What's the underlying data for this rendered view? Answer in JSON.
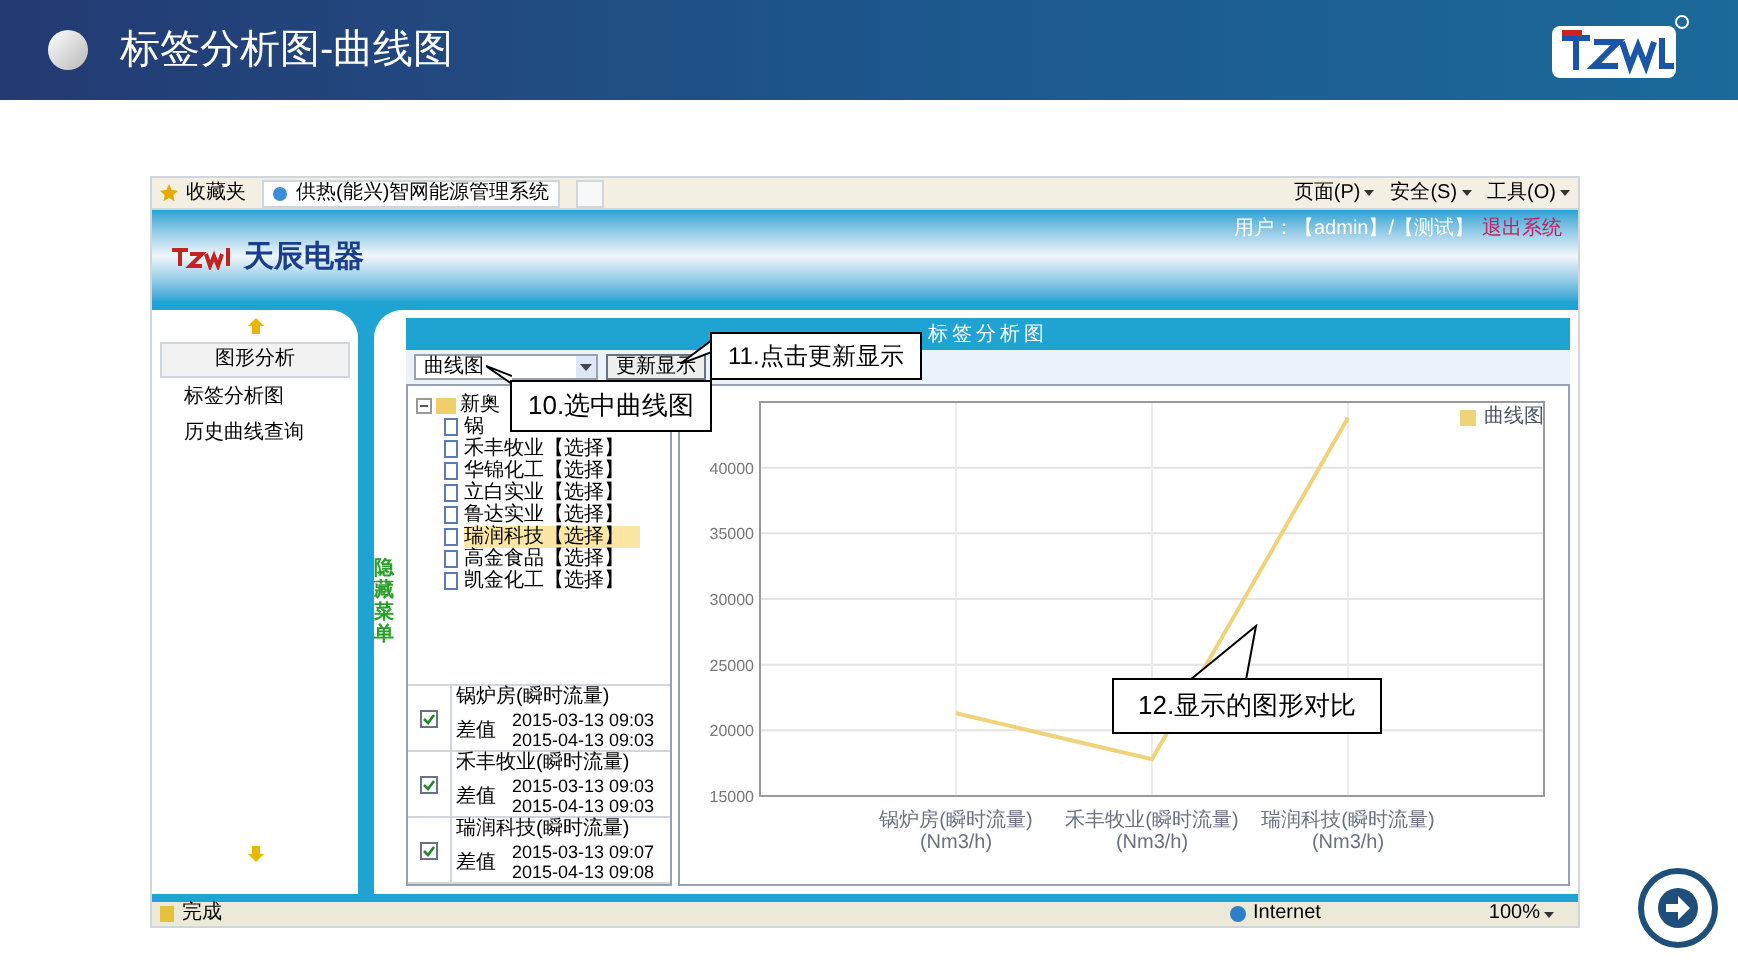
{
  "slide": {
    "title": "标签分析图-曲线图"
  },
  "browser": {
    "favorites": "收藏夹",
    "tab": "供热(能兴)智网能源管理系统",
    "menus": [
      "页面(P)",
      "安全(S)",
      "工具(O)"
    ],
    "status": "完成",
    "zone": "Internet",
    "zoom": "100%"
  },
  "app": {
    "brand": "天辰电器",
    "user": "用户：【admin】/【测试】",
    "logout": "退出系统",
    "sidebar": {
      "items": [
        {
          "label": "图形分析",
          "selected": true
        },
        {
          "label": "标签分析图",
          "selected": false
        },
        {
          "label": "历史曲线查询",
          "selected": false
        }
      ]
    },
    "hide_menu": "隐藏菜单",
    "panel_title": "标签分析图",
    "chart_type": {
      "value": "曲线图"
    },
    "update_button": "更新显示",
    "tree": {
      "label": "新奥",
      "expanded": true,
      "children": [
        {
          "label": "锅",
          "selected": false
        },
        {
          "label": "禾丰牧业【选择】",
          "selected": false
        },
        {
          "label": "华锦化工【选择】",
          "selected": false
        },
        {
          "label": "立白实业【选择】",
          "selected": false
        },
        {
          "label": "鲁达实业【选择】",
          "selected": false
        },
        {
          "label": "瑞润科技【选择】",
          "selected": true
        },
        {
          "label": "高金食品【选择】",
          "selected": false
        },
        {
          "label": "凯金化工【选择】",
          "selected": false
        }
      ]
    },
    "tags": [
      {
        "name": "锅炉房(瞬时流量)",
        "checked": true,
        "mode": "差值",
        "start": "2015-03-13 09:03",
        "end": "2015-04-13 09:03"
      },
      {
        "name": "禾丰牧业(瞬时流量)",
        "checked": true,
        "mode": "差值",
        "start": "2015-03-13 09:03",
        "end": "2015-04-13 09:03"
      },
      {
        "name": "瑞润科技(瞬时流量)",
        "checked": true,
        "mode": "差值",
        "start": "2015-03-13 09:07",
        "end": "2015-04-13 09:08"
      }
    ],
    "chart_data": {
      "type": "line",
      "categories": [
        "锅炉房(瞬时流量)(Nm3/h)",
        "禾丰牧业(瞬时流量)(Nm3/h)",
        "瑞润科技(瞬时流量)(Nm3/h)"
      ],
      "series": [
        {
          "name": "曲线图",
          "color": "#f0d27a",
          "values": [
            21300,
            17800,
            43800
          ]
        }
      ],
      "grid": true,
      "ylim": [
        15000,
        45000
      ],
      "yticks": [
        15000,
        20000,
        25000,
        30000,
        35000,
        40000
      ]
    }
  },
  "callouts": [
    {
      "text": "10.选中曲线图"
    },
    {
      "text": "11.点击更新显示"
    },
    {
      "text": "12.显示的图形对比"
    }
  ]
}
